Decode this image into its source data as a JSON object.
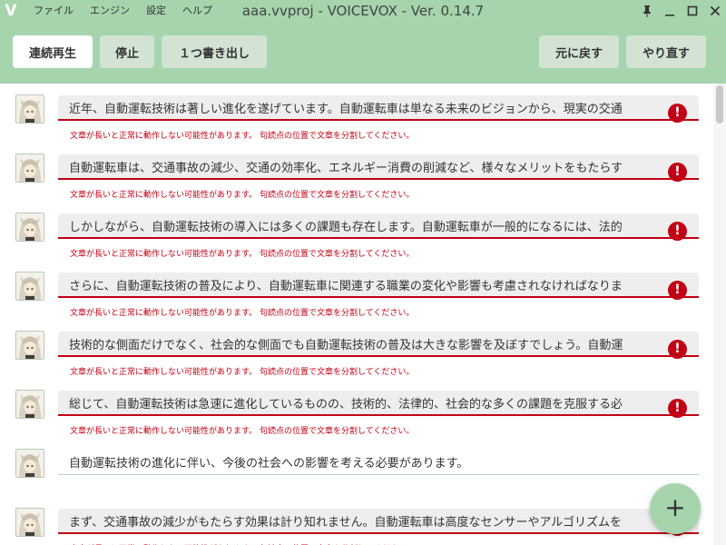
{
  "app": {
    "logo": "V",
    "window_title": "aaa.vvproj - VOICEVOX - Ver. 0.14.7",
    "menus": [
      "ファイル",
      "エンジン",
      "設定",
      "ヘルプ"
    ],
    "window_controls": [
      "pin-icon",
      "minimize-icon",
      "maximize-icon",
      "close-icon"
    ]
  },
  "toolbar": {
    "play_all": "連続再生",
    "stop": "停止",
    "export_one": "１つ書き出し",
    "undo": "元に戻す",
    "redo": "やり直す"
  },
  "colors": {
    "accent": "#a5d4ad",
    "error": "#c10015"
  },
  "cells": [
    {
      "text": "近年、自動運転技術は著しい進化を遂げています。自動運転車は単なる未来のビジョンから、現実の交通",
      "has_error": true,
      "error": "文章が長いと正常に動作しない可能性があります。 句読点の位置で文章を分割してください。"
    },
    {
      "text": "自動運転車は、交通事故の減少、交通の効率化、エネルギー消費の削減など、様々なメリットをもたらす",
      "has_error": true,
      "error": "文章が長いと正常に動作しない可能性があります。 句読点の位置で文章を分割してください。"
    },
    {
      "text": "しかしながら、自動運転技術の導入には多くの課題も存在します。自動運転車が一般的になるには、法的",
      "has_error": true,
      "error": "文章が長いと正常に動作しない可能性があります。 句読点の位置で文章を分割してください。"
    },
    {
      "text": "さらに、自動運転技術の普及により、自動運転車に関連する職業の変化や影響も考慮されなければなりま",
      "has_error": true,
      "error": "文章が長いと正常に動作しない可能性があります。 句読点の位置で文章を分割してください。"
    },
    {
      "text": "技術的な側面だけでなく、社会的な側面でも自動運転技術の普及は大きな影響を及ぼすでしょう。自動運",
      "has_error": true,
      "error": "文章が長いと正常に動作しない可能性があります。 句読点の位置で文章を分割してください。"
    },
    {
      "text": "総じて、自動運転技術は急速に進化しているものの、技術的、法律的、社会的な多くの課題を克服する必",
      "has_error": true,
      "error": "文章が長いと正常に動作しない可能性があります。 句読点の位置で文章を分割してください。"
    },
    {
      "text": "自動運転技術の進化に伴い、今後の社会への影響を考える必要があります。",
      "has_error": false,
      "error": ""
    },
    {
      "text": "まず、交通事故の減少がもたらす効果は計り知れません。自動運転車は高度なセンサーやアルゴリズムを",
      "has_error": true,
      "error": "文章が長いと正常に動作しない可能性があります。 句読点の位置で文章を分割してください。"
    }
  ],
  "fab": {
    "label": "+"
  }
}
